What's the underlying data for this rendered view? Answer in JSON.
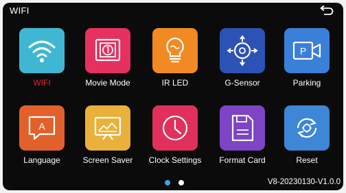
{
  "header": {
    "title": "WIFI",
    "back_icon": "return-arrow-icon"
  },
  "menu": [
    {
      "label": "WIFI",
      "icon": "wifi-icon",
      "color": "#3fb7d3",
      "active": true
    },
    {
      "label": "Movie Mode",
      "icon": "movie-mode-icon",
      "color": "#e6305f",
      "active": false
    },
    {
      "label": "IR LED",
      "icon": "lightbulb-icon",
      "color": "#f28a23",
      "active": false
    },
    {
      "label": "G-Sensor",
      "icon": "g-sensor-icon",
      "color": "#2d52b5",
      "active": false
    },
    {
      "label": "Parking",
      "icon": "parking-icon",
      "color": "#3a7fd8",
      "active": false
    },
    {
      "label": "Language",
      "icon": "language-icon",
      "color": "#e2612a",
      "active": false
    },
    {
      "label": "Screen Saver",
      "icon": "screen-saver-icon",
      "color": "#e9b13b",
      "active": false
    },
    {
      "label": "Clock Settings",
      "icon": "clock-icon",
      "color": "#e2305c",
      "active": false
    },
    {
      "label": "Format Card",
      "icon": "format-card-icon",
      "color": "#7d44c5",
      "active": false
    },
    {
      "label": "Reset",
      "icon": "reset-icon",
      "color": "#3d86d8",
      "active": false
    }
  ],
  "pagination": {
    "pages": 2,
    "current": 1
  },
  "footer": {
    "version": "V8-20230130-V1.0.0"
  },
  "colors": {
    "active_label": "#e02828",
    "label": "#ffffff",
    "background": "#0b0b0b"
  }
}
